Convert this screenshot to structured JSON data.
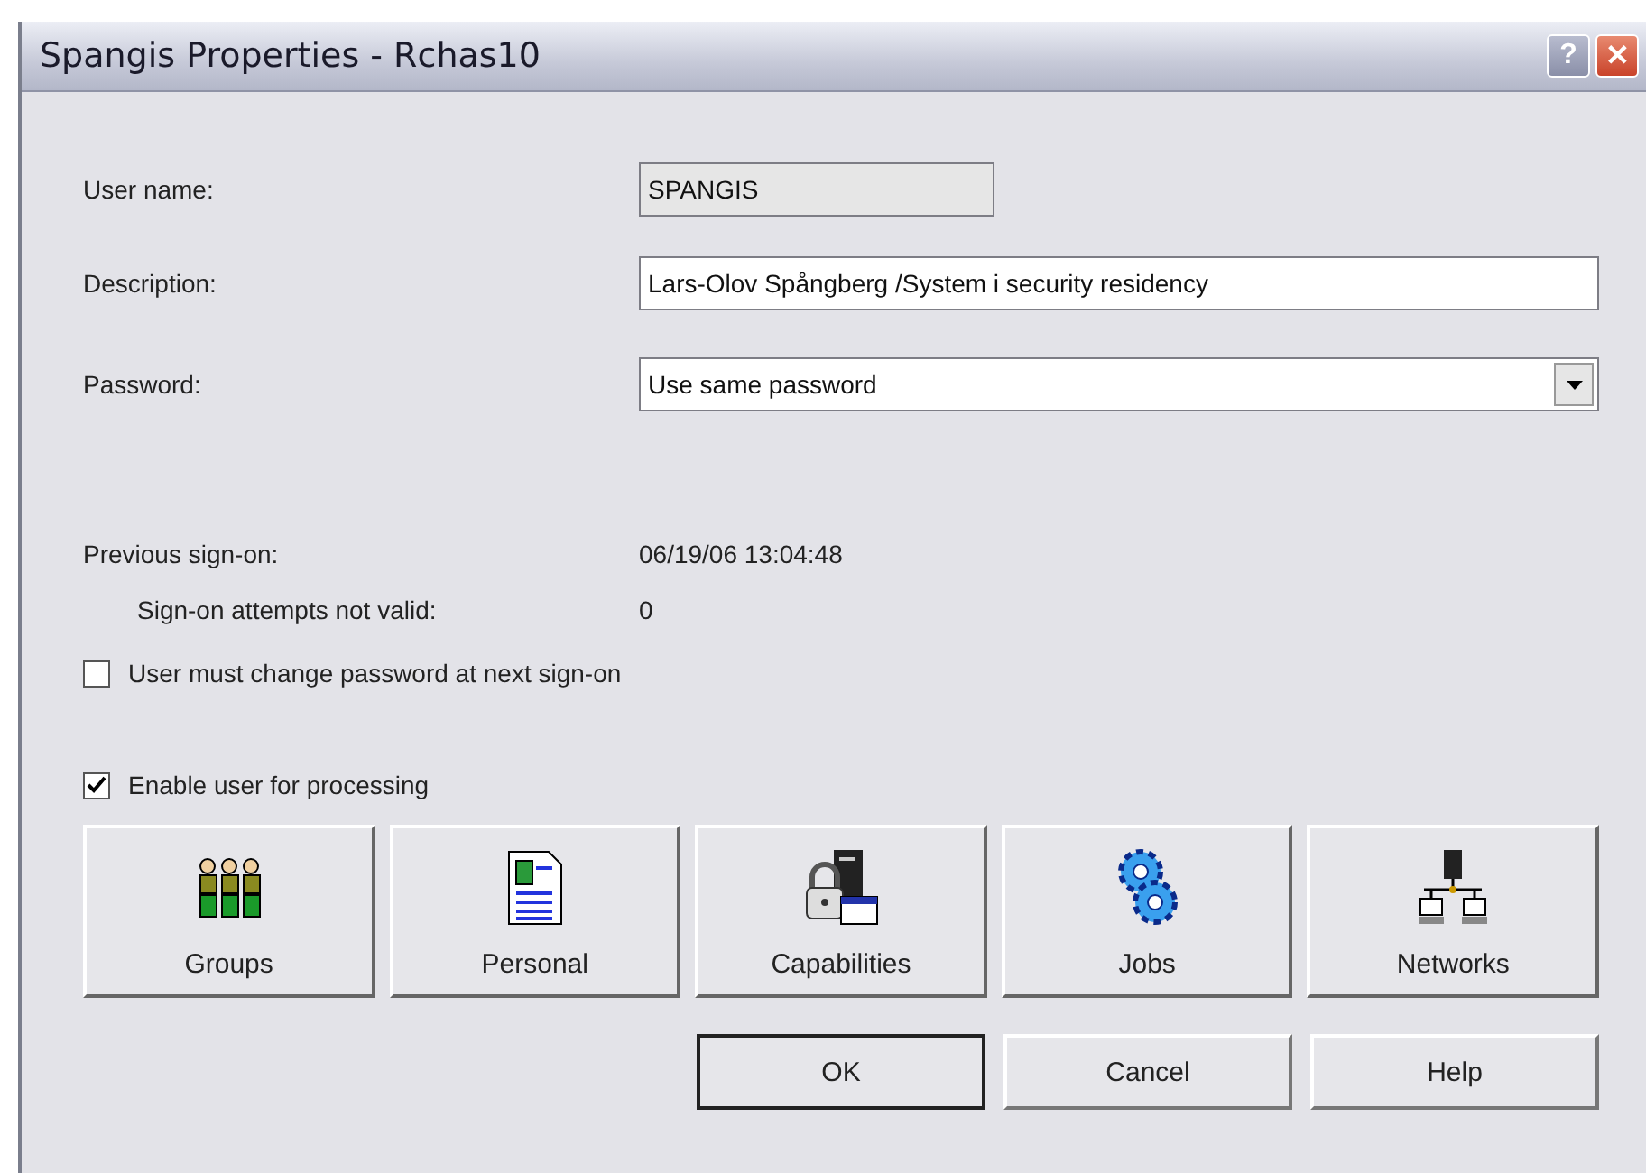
{
  "window": {
    "title": "Spangis Properties - Rchas10",
    "help_button": "?",
    "close_button": "✕"
  },
  "fields": [
    {
      "label": "User name:",
      "kind": "text",
      "value": "SPANGIS",
      "disabled": true
    },
    {
      "label": "Description:",
      "kind": "text",
      "value": "Lars-Olov Spångberg /System i security residency",
      "disabled": false
    },
    {
      "label": "Password:",
      "kind": "combo",
      "value": "Use same password",
      "disabled": false
    }
  ],
  "info": [
    {
      "label": "Previous sign-on:",
      "value": "06/19/06 13:04:48",
      "indented": false
    },
    {
      "label": "Sign-on attempts not valid:",
      "value": "0",
      "indented": true
    }
  ],
  "checkboxes": [
    {
      "label": "User must change password at next sign-on",
      "checked": false
    },
    {
      "label": "Enable user for processing",
      "checked": true
    }
  ],
  "sections": [
    {
      "label": "Groups",
      "kind": "groups"
    },
    {
      "label": "Personal",
      "kind": "personal"
    },
    {
      "label": "Capabilities",
      "kind": "capabilities"
    },
    {
      "label": "Jobs",
      "kind": "jobs"
    },
    {
      "label": "Networks",
      "kind": "networks"
    }
  ],
  "buttons": [
    {
      "label": "OK",
      "default": true
    },
    {
      "label": "Cancel",
      "default": false
    },
    {
      "label": "Help",
      "default": false
    }
  ]
}
